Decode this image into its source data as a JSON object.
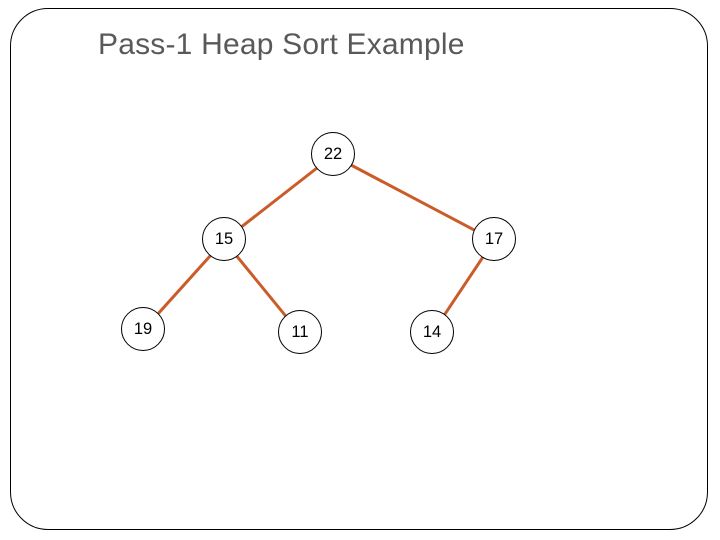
{
  "title": "Pass-1 Heap Sort Example",
  "nodes": {
    "root": {
      "label": "22"
    },
    "l": {
      "label": "15"
    },
    "r": {
      "label": "17"
    },
    "ll": {
      "label": "19"
    },
    "lr": {
      "label": "11"
    },
    "rl": {
      "label": "14"
    }
  }
}
